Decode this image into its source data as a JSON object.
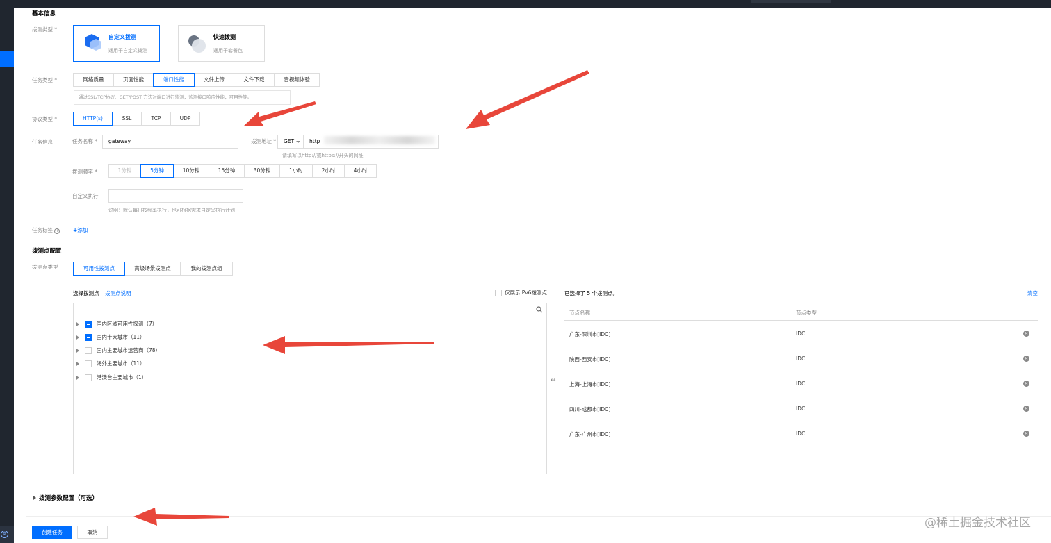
{
  "basic": {
    "title": "基本信息",
    "probe_type_label": "拨测类型",
    "cards": [
      {
        "title": "自定义拨测",
        "desc": "适用于自定义拨测",
        "selected": true
      },
      {
        "title": "快速拨测",
        "desc": "适用于套餐包",
        "selected": false
      }
    ],
    "task_type_label": "任务类型",
    "task_types": [
      "网络质量",
      "页面性能",
      "端口性能",
      "文件上传",
      "文件下载",
      "音视频体验"
    ],
    "task_type_selected": "端口性能",
    "task_type_hint": "通过SSL/TCP协议、GET/POST 方法对端口进行监测，监测接口响应性能，可用性等。",
    "protocol_label": "协议类型",
    "protocols": [
      "HTTP(s)",
      "SSL",
      "TCP",
      "UDP"
    ],
    "protocol_selected": "HTTP(s)",
    "task_info_label": "任务信息",
    "task_name_label": "任务名称",
    "task_name_value": "gateway",
    "address_label": "拨测地址",
    "method_value": "GET",
    "address_value": "http",
    "address_hint": "请填写以http://或https://开头的网址",
    "frequency_label": "拨测频率",
    "frequencies": [
      "1分钟",
      "5分钟",
      "10分钟",
      "15分钟",
      "30分钟",
      "1小时",
      "2小时",
      "4小时"
    ],
    "frequency_selected": "5分钟",
    "frequency_disabled": "1分钟",
    "custom_exec_label": "自定义执行",
    "custom_exec_hint": "说明：默认每日按频率执行，也可根据需求自定义执行计划",
    "task_tag_label": "任务标签",
    "add_tag": "添加"
  },
  "probe": {
    "title": "拨测点配置",
    "point_type_label": "拨测点类型",
    "point_types": [
      "可用性拨测点",
      "高级场景拨测点",
      "我的拨测点组"
    ],
    "point_type_selected": "可用性拨测点",
    "select_label": "选择拨测点",
    "select_link": "拨测点说明",
    "ipv6_label": "仅展示IPv6拨测点",
    "tree": [
      {
        "label": "国内区域可用性探测（7）",
        "state": "partial"
      },
      {
        "label": "国内十大城市（11）",
        "state": "partial"
      },
      {
        "label": "国内主要城市运营商（78）",
        "state": "none"
      },
      {
        "label": "海外主要城市（11）",
        "state": "none"
      },
      {
        "label": "港澳台主要城市（1）",
        "state": "none"
      }
    ],
    "selected_summary": "已选择了 5 个拨测点。",
    "clear_label": "清空",
    "columns": [
      "节点名称",
      "节点类型"
    ],
    "selected": [
      {
        "name": "广东-深圳市[IDC]",
        "type": "IDC"
      },
      {
        "name": "陕西-西安市[IDC]",
        "type": "IDC"
      },
      {
        "name": "上海-上海市[IDC]",
        "type": "IDC"
      },
      {
        "name": "四川-成都市[IDC]",
        "type": "IDC"
      },
      {
        "name": "广东-广州市[IDC]",
        "type": "IDC"
      }
    ],
    "swap_icon": "↔"
  },
  "params": {
    "title": "拨测参数配置（可选）"
  },
  "footer": {
    "create": "创建任务",
    "cancel": "取消"
  },
  "watermark": "@稀土掘金技术社区",
  "colors": {
    "accent": "#006eff",
    "annotation": "#e8463a",
    "nav": "#20262f"
  }
}
